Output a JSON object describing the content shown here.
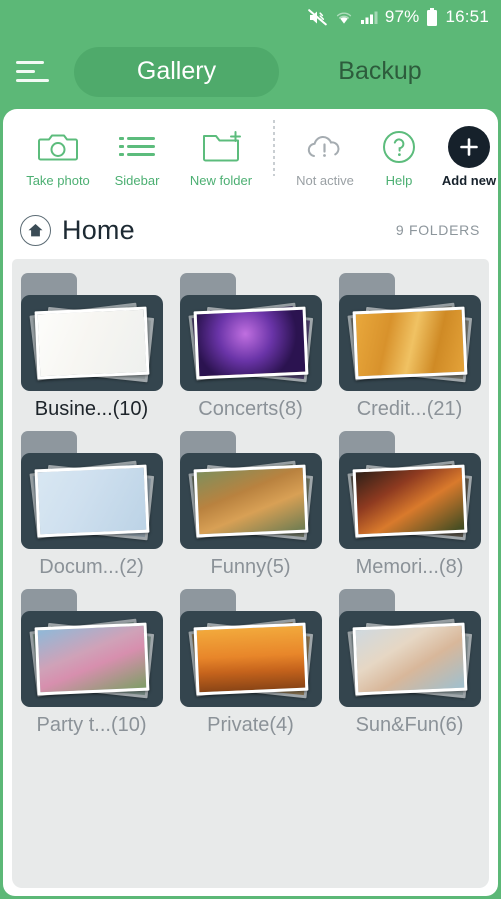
{
  "status_bar": {
    "battery_percent": "97%",
    "time": "16:51",
    "icons": [
      "mute-icon",
      "wifi-icon",
      "cellular-signal-icon",
      "battery-icon"
    ]
  },
  "header": {
    "menu_icon": "hamburger-menu-icon",
    "tabs": [
      {
        "label": "Gallery",
        "active": true
      },
      {
        "label": "Backup",
        "active": false
      }
    ]
  },
  "toolbar": {
    "items": [
      {
        "id": "take-photo",
        "label": "Take photo",
        "icon": "camera-icon",
        "style": "green"
      },
      {
        "id": "sidebar",
        "label": "Sidebar",
        "icon": "list-icon",
        "style": "green"
      },
      {
        "id": "new-folder",
        "label": "New folder",
        "icon": "folder-plus-icon",
        "style": "green"
      },
      {
        "id": "not-active",
        "label": "Not active",
        "icon": "cloud-alert-icon",
        "style": "gray"
      },
      {
        "id": "help",
        "label": "Help",
        "icon": "question-circle-icon",
        "style": "green"
      },
      {
        "id": "add-new",
        "label": "Add new",
        "icon": "plus-circle-icon",
        "style": "dark"
      }
    ]
  },
  "breadcrumb": {
    "icon": "home-icon",
    "title": "Home",
    "count_label": "9 FOLDERS"
  },
  "folders": [
    {
      "label": "Busine...(10)",
      "thumb": "business-notes",
      "active": true
    },
    {
      "label": "Concerts(8)",
      "thumb": "concert-stage",
      "active": false
    },
    {
      "label": "Credit...(21)",
      "thumb": "credit-card",
      "active": false
    },
    {
      "label": "Docum...(2)",
      "thumb": "id-document",
      "active": false
    },
    {
      "label": "Funny(5)",
      "thumb": "dog-portrait",
      "active": false
    },
    {
      "label": "Memori...(8)",
      "thumb": "autumn-forest",
      "active": false
    },
    {
      "label": "Party t...(10)",
      "thumb": "kids-party",
      "active": false
    },
    {
      "label": "Private(4)",
      "thumb": "sunset-couple",
      "active": false
    },
    {
      "label": "Sun&Fun(6)",
      "thumb": "beach-couple",
      "active": false
    }
  ],
  "colors": {
    "header_green": "#5cb877",
    "tab_active_green": "#4faa6b",
    "accent_green": "#4caf72",
    "folder_body": "#34454e",
    "folder_tab": "#8e979e",
    "panel_gray": "#e8eaea",
    "dark_button": "#16212b"
  }
}
